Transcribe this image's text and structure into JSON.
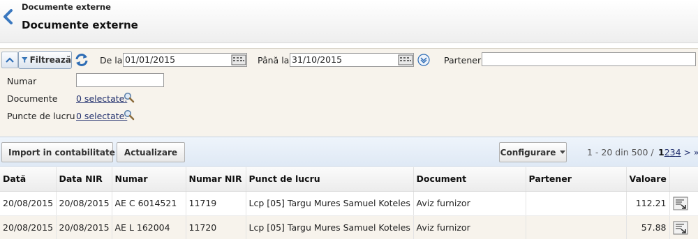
{
  "header": {
    "breadcrumb": "Documente externe",
    "title": "Documente externe"
  },
  "filters": {
    "filter_label": "Filtrează",
    "date_from_label": "De la",
    "date_from_value": "01/01/2015",
    "date_to_label": "Până la",
    "date_to_value": "31/10/2015",
    "partner_label": "Partener",
    "partner_value": "",
    "number_label": "Numar",
    "number_value": "",
    "documents_label": "Documente",
    "documents_link": "0 selectate.",
    "workpoints_label": "Puncte de lucru",
    "workpoints_link": "0 selectate."
  },
  "toolbar": {
    "import_label": "Import in contabilitate",
    "update_label": "Actualizare",
    "config_label": "Configurare",
    "pager_range": "1 - 20 din 500 /",
    "pages": [
      "1",
      "2",
      "3",
      "4"
    ],
    "next": ">",
    "last": "»"
  },
  "table": {
    "columns": [
      "Dată",
      "Data NIR",
      "Numar",
      "Numar NIR",
      "Punct de lucru",
      "Document",
      "Partener",
      "Valoare",
      ""
    ],
    "rows": [
      {
        "data": "20/08/2015",
        "data_nir": "20/08/2015",
        "numar": "AE C 6014521",
        "numar_nir": "11719",
        "punct": "Lcp [05] Targu Mures Samuel Koteles",
        "document": "Aviz furnizor",
        "partener": "",
        "valoare": "112.21"
      },
      {
        "data": "20/08/2015",
        "data_nir": "20/08/2015",
        "numar": "AE L 162004",
        "numar_nir": "11720",
        "punct": "Lcp [05] Targu Mures Samuel Koteles",
        "document": "Aviz furnizor",
        "partener": "",
        "valoare": "57.88"
      }
    ]
  },
  "colors": {
    "accent_blue": "#2f6db5",
    "panel_beige": "#f7f3ec",
    "link": "#22306e"
  }
}
